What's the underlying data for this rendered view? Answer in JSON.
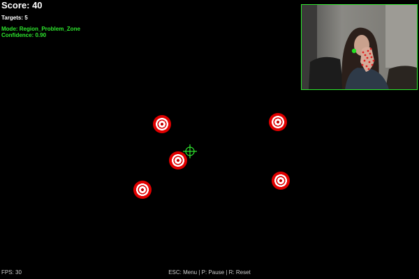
{
  "hud": {
    "score": "Score: 40",
    "targets": "Targets: 5",
    "mode": "Mode: Region_Problem_Zone",
    "confidence": "Confidence: 0.90",
    "fps": "FPS: 30",
    "controls": "ESC: Menu | P: Pause | R: Reset"
  },
  "colors": {
    "hud_green": "#2ee82e",
    "target_red": "#e00000",
    "background": "#000000"
  },
  "icons": {
    "crosshair": "crosshair-icon",
    "target": "bullseye-target-icon"
  }
}
